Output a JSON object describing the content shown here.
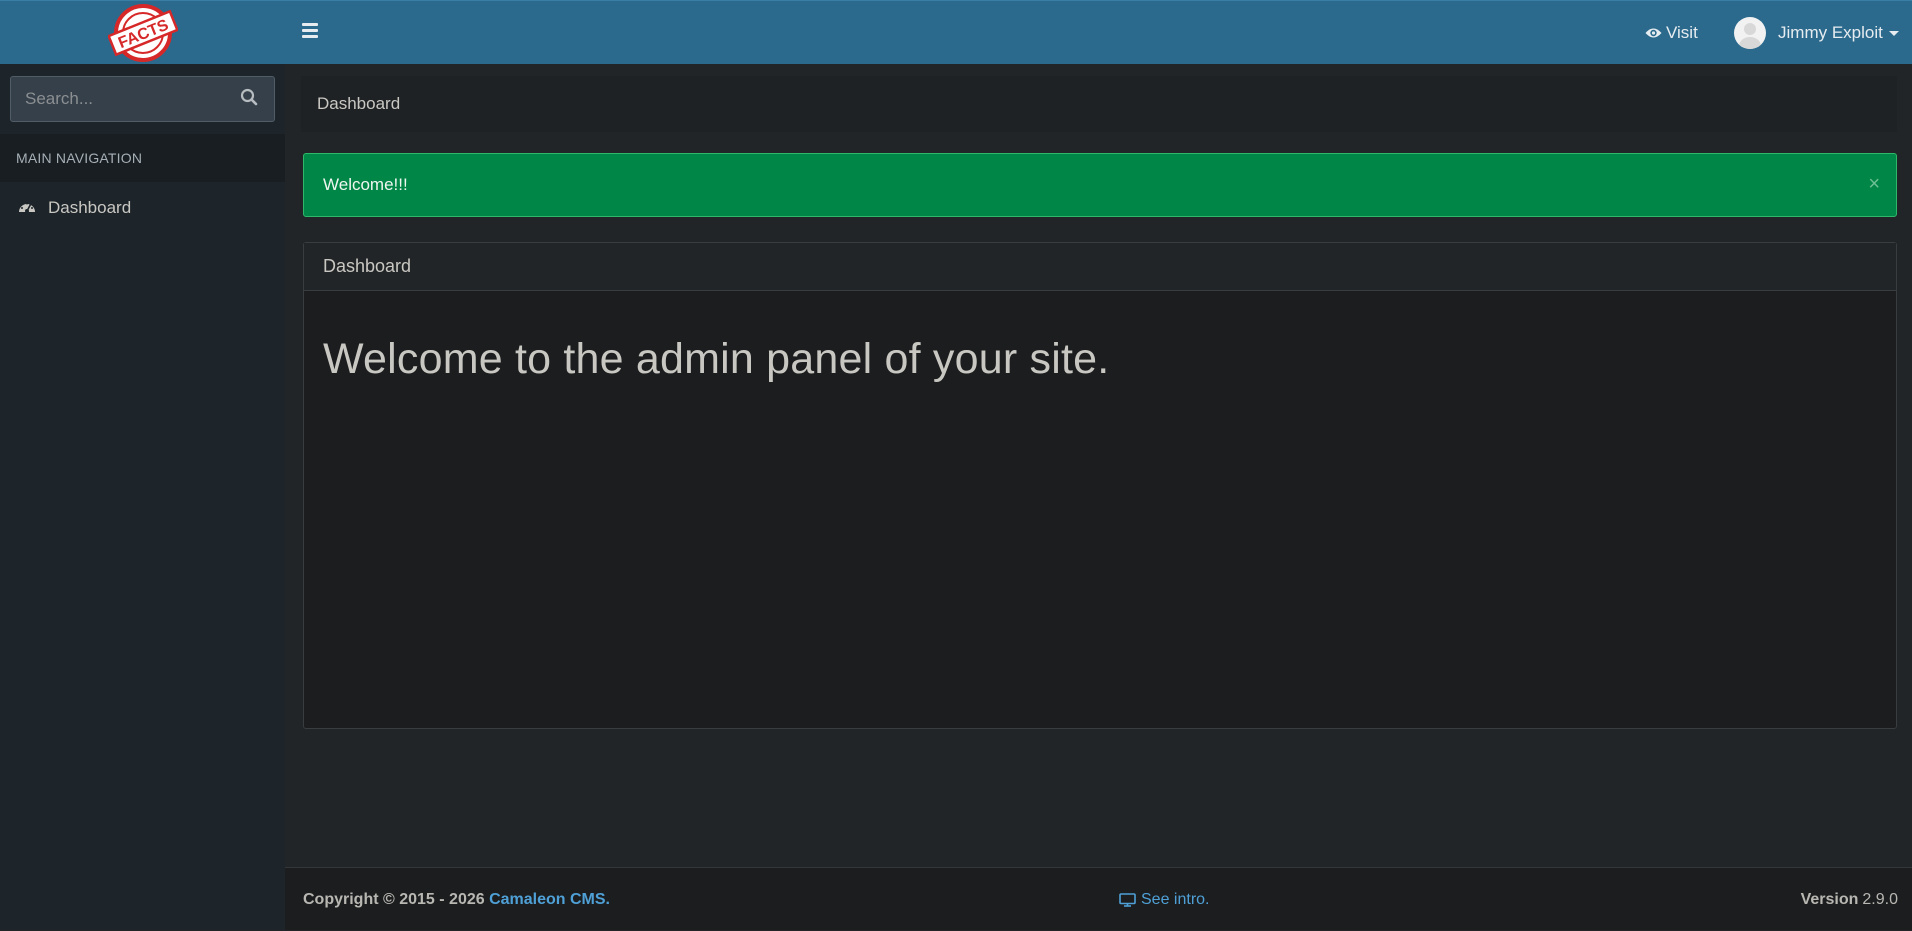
{
  "header": {
    "logo_text": "FACTS",
    "visit_label": "Visit",
    "user_name": "Jimmy Exploit"
  },
  "sidebar": {
    "search_placeholder": "Search...",
    "nav_header": "MAIN NAVIGATION",
    "items": [
      {
        "label": "Dashboard",
        "icon": "dashboard-icon"
      }
    ]
  },
  "main": {
    "breadcrumb": "Dashboard",
    "alert_text": "Welcome!!!",
    "alert_close": "×",
    "panel_title": "Dashboard",
    "panel_message": "Welcome to the admin panel of your site."
  },
  "footer": {
    "copyright_prefix": "Copyright © 2015 - 2026 ",
    "brand_link": "Camaleon CMS.",
    "intro_link": "See intro.",
    "version_label": "Version",
    "version_number": "2.9.0"
  },
  "colors": {
    "header_bg": "#2b6a8d",
    "sidebar_bg": "#1d252b",
    "content_bg": "#222527",
    "alert_bg": "#008647",
    "link": "#4fa0d6",
    "logo_red": "#d62828"
  }
}
